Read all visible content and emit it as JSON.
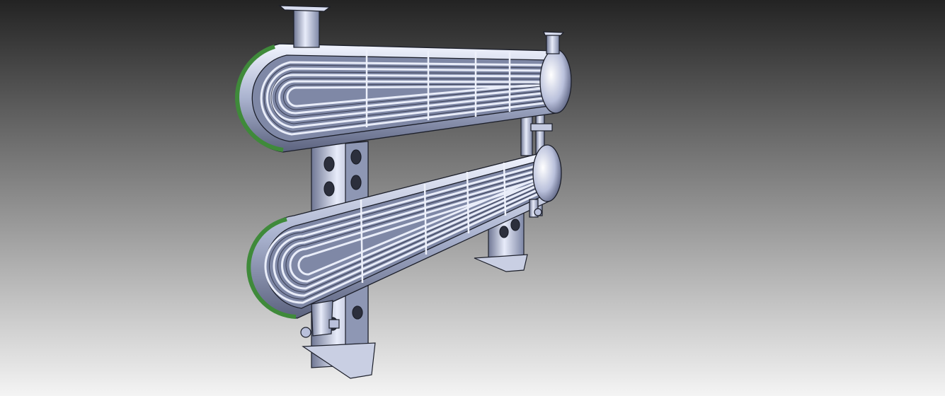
{
  "viewport": {
    "background_top": "#232323",
    "background_bottom": "#f4f4f4"
  },
  "model": {
    "subject": "u-tube-heat-exchanger-stack",
    "colors": {
      "metal_light": "#dde3f4",
      "metal_mid": "#aab3cf",
      "metal_dark": "#4a506a",
      "edge": "#1c1f2a",
      "accent_green": "#3f8a3a"
    }
  }
}
